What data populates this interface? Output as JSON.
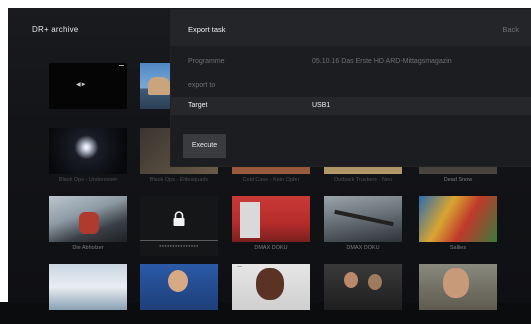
{
  "app": {
    "title": "DR+ archive"
  },
  "dialog": {
    "title": "Export task",
    "back_label": "Back",
    "rows": [
      {
        "label": "Programme",
        "value": "05.10.16 Das Erste HD ARD-Mittagsmagazin"
      },
      {
        "label": "export to",
        "value": ""
      },
      {
        "label": "Target",
        "value": "USB1"
      }
    ],
    "execute_label": "Execute"
  },
  "grid": {
    "row1": [
      {
        "caption": "",
        "thumb_text": "◀◀▶"
      },
      {
        "caption": ""
      }
    ],
    "row2": [
      {
        "caption": "Black Ops - Undercover"
      },
      {
        "caption": "Black Ops - Elitesquads"
      },
      {
        "caption": "Cold Case - Kein Opfer"
      },
      {
        "caption": "Outback Truckers - Neu"
      },
      {
        "caption": "Dead Snow"
      }
    ],
    "row3": [
      {
        "caption": "Die Abholzer"
      },
      {
        "caption": "***************"
      },
      {
        "caption": "DMAX DOKU"
      },
      {
        "caption": "DMAX DOKU"
      },
      {
        "caption": "Sallies"
      }
    ],
    "row4": [
      {
        "caption": ""
      },
      {
        "caption": ""
      },
      {
        "caption": ""
      },
      {
        "caption": ""
      },
      {
        "caption": ""
      }
    ]
  },
  "icons": {
    "lock": "lock-icon"
  }
}
